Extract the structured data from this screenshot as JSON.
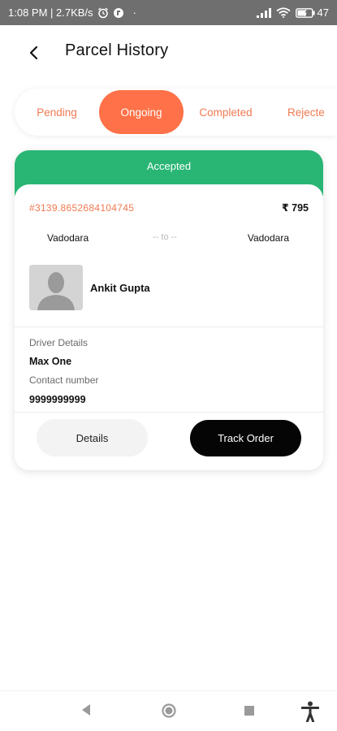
{
  "status_bar": {
    "time_speed": "1:08 PM | 2.7KB/s",
    "dot": "·",
    "battery": "47"
  },
  "header": {
    "title": "Parcel History"
  },
  "tabs": [
    {
      "label": "Pending",
      "active": false
    },
    {
      "label": "Ongoing",
      "active": true
    },
    {
      "label": "Completed",
      "active": false
    },
    {
      "label": "Rejecte",
      "active": false
    }
  ],
  "order": {
    "status": "Accepted",
    "id": "#3139.8652684104745",
    "price": "₹ 795",
    "from": "Vadodara",
    "route_sep": "-- to --",
    "to": "Vadodara",
    "customer_name": "Ankit Gupta",
    "driver_label": "Driver Details",
    "driver_name": "Max One",
    "contact_label": "Contact number",
    "contact_number": "9999999999",
    "details_button": "Details",
    "track_button": "Track Order"
  },
  "colors": {
    "accent": "#ff7148",
    "accent_text": "#f07a52",
    "status_green": "#29b574"
  },
  "icons": {
    "back": "back-arrow-icon",
    "avatar": "user-placeholder-icon",
    "nav_back": "nav-back-icon",
    "nav_home": "nav-home-icon",
    "nav_recents": "nav-recents-icon",
    "accessibility": "accessibility-icon"
  }
}
